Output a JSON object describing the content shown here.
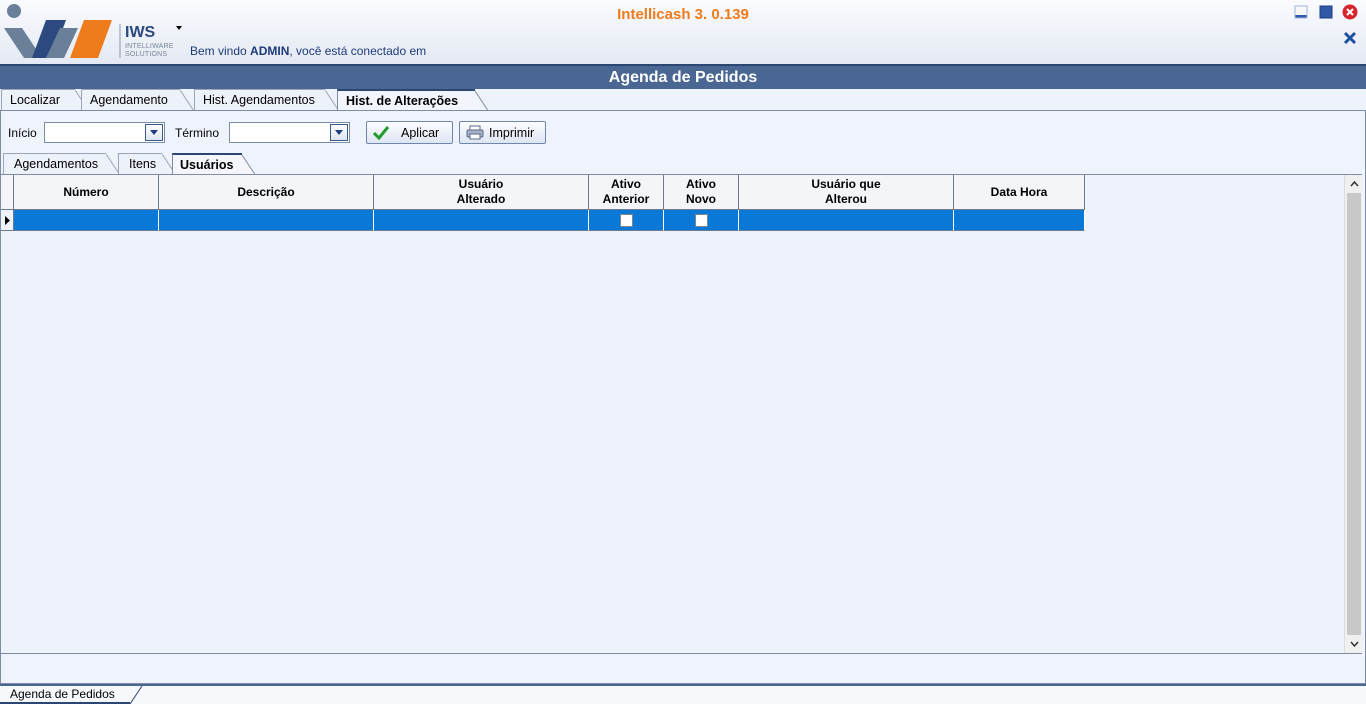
{
  "app": {
    "title": "Intellicash 3. 0.139",
    "logo_text": "IWS",
    "logo_sub1": "INTELLIWARE",
    "logo_sub2": "SOLUTIONS",
    "welcome_prefix": "Bem vindo",
    "welcome_user": "ADMIN",
    "welcome_suffix": ", você está conectado em"
  },
  "window": {
    "title": "Agenda de Pedidos"
  },
  "tabs": [
    {
      "label": "Localizar"
    },
    {
      "label": "Agendamento"
    },
    {
      "label": "Hist. Agendamentos"
    },
    {
      "label": "Hist. de Alterações"
    }
  ],
  "filters": {
    "inicio_label": "Início",
    "inicio_value": "",
    "termino_label": "Término",
    "termino_value": "",
    "apply_label": "Aplicar",
    "print_label": "Imprimir"
  },
  "subtabs": [
    {
      "label": "Agendamentos"
    },
    {
      "label": "Itens"
    },
    {
      "label": "Usuários"
    }
  ],
  "grid": {
    "columns": [
      {
        "line1": "Número",
        "line2": ""
      },
      {
        "line1": "Descrição",
        "line2": ""
      },
      {
        "line1": "Usuário",
        "line2": "Alterado"
      },
      {
        "line1": "Ativo",
        "line2": "Anterior"
      },
      {
        "line1": "Ativo",
        "line2": "Novo"
      },
      {
        "line1": "Usuário que",
        "line2": "Alterou"
      },
      {
        "line1": "Data Hora",
        "line2": ""
      }
    ],
    "rows": [
      {
        "numero": "",
        "descricao": "",
        "usuario_alterado": "",
        "ativo_anterior": false,
        "ativo_novo": false,
        "usuario_que_alterou": "",
        "data_hora": ""
      }
    ]
  },
  "bottom": {
    "tab_label": "Agenda de Pedidos"
  },
  "colors": {
    "accent_orange": "#ee7b1c",
    "title_bar": "#4a6692",
    "selected_row": "#0a78d7"
  }
}
